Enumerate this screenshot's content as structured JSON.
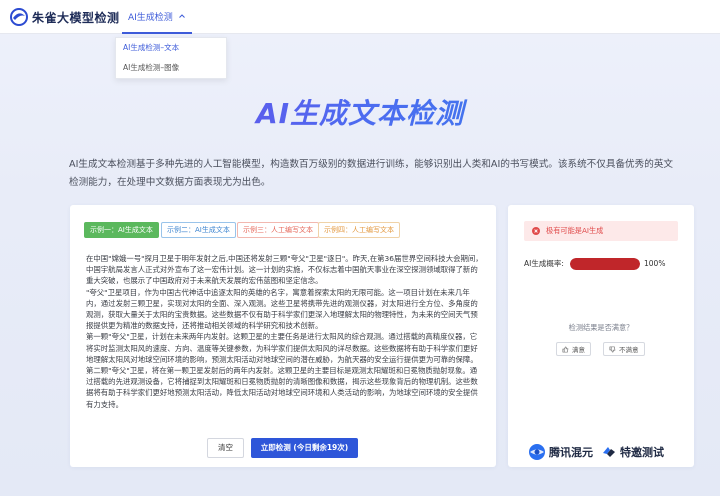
{
  "header": {
    "logo_text": "朱雀大模型检测",
    "nav_label": "AI生成检测"
  },
  "dropdown": {
    "items": [
      {
        "label": "AI生成检测–文本",
        "active": true
      },
      {
        "label": "AI生成检测–图像",
        "active": false
      }
    ]
  },
  "hero": {
    "title": "AI生成文本检测",
    "description": "AI生成文本检测基于多种先进的人工智能模型，构造数百万级别的数据进行训练，能够识别出人类和AI的书写模式。该系统不仅具备优秀的英文检测能力，在处理中文数据方面表现尤为出色。"
  },
  "examples": [
    {
      "label": "示例一：AI生成文本"
    },
    {
      "label": "示例二：AI生成文本"
    },
    {
      "label": "示例三：人工编写文本"
    },
    {
      "label": "示例四：人工编写文本"
    }
  ],
  "article": {
    "paragraphs": [
      "在中国\"嫦娥一号\"探月卫星于明年发射之后,中国还将发射三颗\"夸父\"卫星\"逐日\"。昨天,在第36届世界空间科技大会期间，中国宇航局发言人正式对外宣布了这一宏伟计划。这一计划的实施，不仅标志着中国航天事业在深空探测领域取得了新的重大突破，也展示了中国政府对于未来航天发展的宏伟蓝图和坚定信念。",
      "\"夸父\"卫星项目，作为中国古代神话中追逐太阳的英雄的名字，寓意着探索太阳的无限可能。这一项目计划在未来几年内，通过发射三颗卫星，实现对太阳的全面、深入观测。这些卫星将携带先进的观测仪器，对太阳进行全方位、多角度的观测，获取大量关于太阳的宝贵数据。这些数据不仅有助于科学家们更深入地理解太阳的物理特性，为未来的空间天气预报提供更为精准的数据支持，还将推动相关领域的科学研究和技术创新。",
      "第一颗\"夸父\"卫星，计划在未来两年内发射。这颗卫星的主要任务是进行太阳风的综合观测。通过搭载的高精度仪器，它将实时监测太阳风的速度、方向、温度等关键参数，为科学家们提供太阳风的详尽数据。这些数据将有助于科学家们更好地理解太阳风对地球空间环境的影响，预测太阳活动对地球空间的潜在威胁，为航天器的安全运行提供更为可靠的保障。",
      "第二颗\"夸父\"卫星，将在第一颗卫星发射后的两年内发射。这颗卫星的主要目标是观测太阳耀斑和日冕物质抛射现象。通过搭载的先进观测设备，它将捕捉到太阳耀斑和日冕物质抛射的清晰图像和数据，揭示这些现象背后的物理机制。这些数据将有助于科学家们更好地预测太阳活动，降低太阳活动对地球空间环境和人类活动的影响，为地球空间环境的安全提供有力支持。"
    ]
  },
  "actions": {
    "clear_label": "清空",
    "detect_label": "立即检测 (今日剩余19次)"
  },
  "result": {
    "alert_text": "极有可能是AI生成",
    "prob_label": "AI生成概率:",
    "prob_value": 1.0,
    "prob_text": "100%",
    "satisfaction_question": "检测结果是否满意？",
    "yes_label": "满意",
    "no_label": "不满意",
    "partner1": "腾讯混元",
    "partner2": "特邀测试"
  },
  "colors": {
    "accent": "#2e56d9",
    "danger": "#c0262a",
    "example1": "#5bb85d"
  }
}
